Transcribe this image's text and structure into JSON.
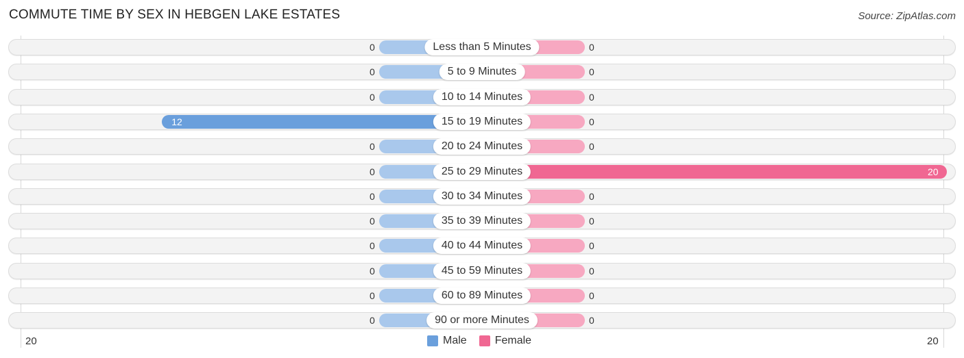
{
  "header": {
    "title": "COMMUTE TIME BY SEX IN HEBGEN LAKE ESTATES",
    "source": "Source: ZipAtlas.com"
  },
  "colors": {
    "male": "#6a9fdc",
    "male_light": "#a9c8ec",
    "female": "#f06792",
    "female_light": "#f7a8c1",
    "track": "#f3f3f3"
  },
  "chart_data": {
    "type": "bar",
    "orientation": "horizontal-diverging",
    "title": "COMMUTE TIME BY SEX IN HEBGEN LAKE ESTATES",
    "categories": [
      "Less than 5 Minutes",
      "5 to 9 Minutes",
      "10 to 14 Minutes",
      "15 to 19 Minutes",
      "20 to 24 Minutes",
      "25 to 29 Minutes",
      "30 to 34 Minutes",
      "35 to 39 Minutes",
      "40 to 44 Minutes",
      "45 to 59 Minutes",
      "60 to 89 Minutes",
      "90 or more Minutes"
    ],
    "series": [
      {
        "name": "Male",
        "values": [
          0,
          0,
          0,
          12,
          0,
          0,
          0,
          0,
          0,
          0,
          0,
          0
        ]
      },
      {
        "name": "Female",
        "values": [
          0,
          0,
          0,
          0,
          0,
          20,
          0,
          0,
          0,
          0,
          0,
          0
        ]
      }
    ],
    "axis": {
      "left_max_label": "20",
      "right_max_label": "20",
      "max": 20
    },
    "legend": {
      "position": "bottom-center",
      "entries": [
        "Male",
        "Female"
      ]
    }
  }
}
